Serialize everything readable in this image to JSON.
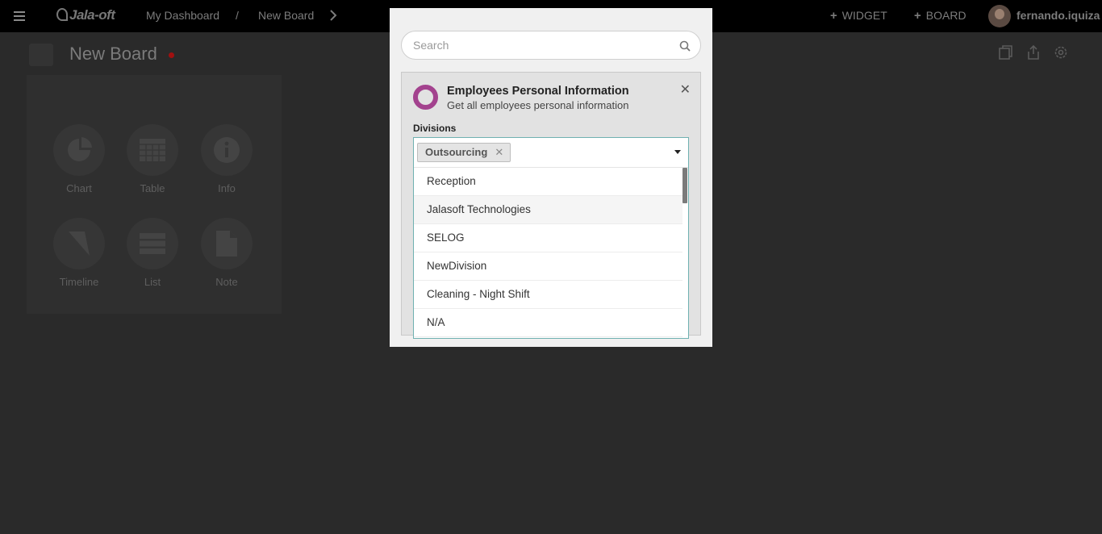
{
  "header": {
    "logo_text": "Jala-oft",
    "breadcrumb": [
      "My Dashboard",
      "/",
      "New Board"
    ],
    "widget_label": "WIDGET",
    "board_label": "BOARD",
    "username": "fernando.iquiza"
  },
  "board": {
    "title": "New Board",
    "status_color": "#a01010"
  },
  "widget_types": [
    {
      "label": "Chart",
      "icon": "pie-chart-icon"
    },
    {
      "label": "Table",
      "icon": "table-icon"
    },
    {
      "label": "Info",
      "icon": "info-icon"
    },
    {
      "label": "Timeline",
      "icon": "timeline-icon"
    },
    {
      "label": "List",
      "icon": "list-icon"
    },
    {
      "label": "Note",
      "icon": "note-icon"
    }
  ],
  "modal": {
    "search_placeholder": "Search",
    "card": {
      "title": "Employees Personal Information",
      "description": "Get all employees personal information",
      "accent_color": "#a3428e",
      "field_label": "Divisions",
      "selected_tag": "Outsourcing",
      "options": [
        "Reception",
        "Jalasoft Technologies",
        "SELOG",
        "NewDivision",
        "Cleaning - Night Shift",
        "N/A"
      ],
      "hovered_option": "Jalasoft Technologies"
    }
  }
}
